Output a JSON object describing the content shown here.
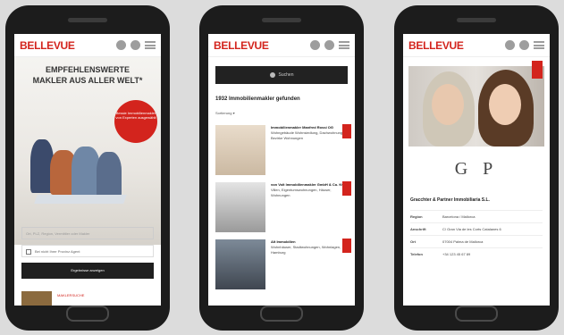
{
  "brand": {
    "logo": "BELLEVUE",
    "accent": "#d3241d"
  },
  "screen1": {
    "heading_line1": "EMPFEHLENSWERTE",
    "heading_line2": "MAKLER AUS ALLER WELT*",
    "badge_text": "Bessie Immobilienmakler von Experten ausgewählt",
    "search_placeholder": "Ort, PLZ, Region, Vermittler oder Makler",
    "checkbox_label": "Bei nicht Ihrer Provinz Agent",
    "button_label": "Ergebnisse anzeigen",
    "teaser_label": "MAKLERSUCHE"
  },
  "screen2": {
    "search_label": "Suchen",
    "results_title": "1932 Immobilienmakler gefunden",
    "sort_label": "Sortierung",
    "agents": [
      {
        "name": "Immobilienmakler Manfred Rossi OG",
        "desc": "Wohngebäude Wohnsiedlung, Dachwohnung Bezirke Wohnungen",
        "badge": "GP"
      },
      {
        "name": "von Voit Immobilienmakler GmbH & Co. KG",
        "desc": "Villen, Eigentumswohnungen, Häuser, Wohnungen",
        "badge": "GP"
      },
      {
        "name": "Alt Immobilien",
        "desc": "Wohnhäuser, Stadtwohnungen, Wohnlagen, Hamburg",
        "badge": "GP"
      }
    ]
  },
  "screen3": {
    "logo_text": "G P",
    "agency_name": "Gracchter & Partner Immobiliaria S.L.",
    "info": [
      {
        "k": "Region",
        "v": "Barcelona / Mallorca"
      },
      {
        "k": "Anschrift",
        "v": "C/ Gran Via de les Corts Catalanes 6"
      },
      {
        "k": "Ort",
        "v": "07004 Palma de Mallorca"
      },
      {
        "k": "Telefon",
        "v": "+34 123 45 67 89"
      }
    ],
    "badge": "GP"
  }
}
